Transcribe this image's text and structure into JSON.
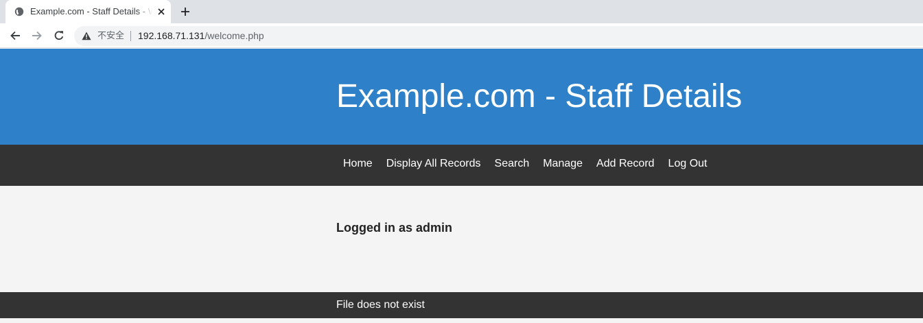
{
  "browser": {
    "tab": {
      "title": "Example.com - Staff Details - Welcome",
      "favicon": "globe-icon",
      "close_icon": "close-icon"
    },
    "new_tab_icon": "plus-icon",
    "nav": {
      "back_icon": "back-arrow-icon",
      "forward_icon": "forward-arrow-icon",
      "reload_icon": "reload-icon"
    },
    "address_bar": {
      "security_icon": "warning-triangle-icon",
      "security_label": "不安全",
      "host": "192.168.71.131",
      "path": "/welcome.php"
    }
  },
  "site": {
    "title": "Example.com - Staff Details",
    "nav": [
      {
        "label": "Home"
      },
      {
        "label": "Display All Records"
      },
      {
        "label": "Search"
      },
      {
        "label": "Manage"
      },
      {
        "label": "Add Record"
      },
      {
        "label": "Log Out"
      }
    ],
    "content": {
      "status": "Logged in as admin"
    },
    "footer": {
      "message": "File does not exist"
    }
  },
  "colors": {
    "header": "#2e81c8",
    "nav_bar": "#333333",
    "footer": "#333333",
    "body": "#f4f4f4"
  }
}
